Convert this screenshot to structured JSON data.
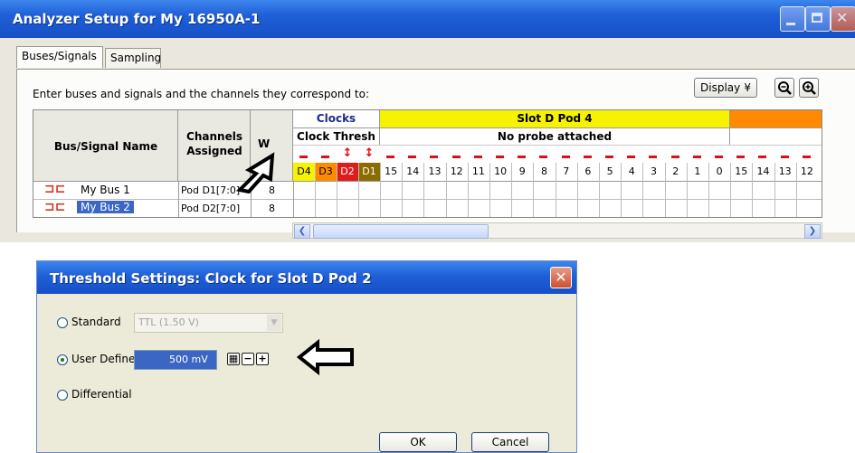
{
  "main_window": {
    "title": "Analyzer Setup for My 16950A-1",
    "tabs": [
      {
        "label": "Buses/Signals",
        "active": true
      },
      {
        "label": "Sampling",
        "active": false
      }
    ],
    "instruction": "Enter buses and signals and the channels they correspond to:",
    "display_button": "Display",
    "display_chevron": "¥",
    "table": {
      "col_bus_signal_name": "Bus/Signal Name",
      "col_channels": "Channels",
      "col_assigned": "Assigned",
      "col_width": "W",
      "clocks_group": "Clocks",
      "clock_thresh_label": "Clock Thresh",
      "slot_label": "Slot D Pod 4",
      "no_probe_label": "No probe attached",
      "clock_channels": [
        "D4",
        "D3",
        "D2",
        "D1"
      ],
      "pod_channels": [
        "15",
        "14",
        "13",
        "12",
        "11",
        "10",
        "9",
        "8",
        "7",
        "6",
        "5",
        "4",
        "3",
        "2",
        "1",
        "0"
      ],
      "next_pod_channels": [
        "15",
        "14",
        "13",
        "12"
      ],
      "rows": [
        {
          "name": "My Bus 1",
          "channels": "Pod D1[7:0]",
          "width": "8",
          "selected": false
        },
        {
          "name": "My Bus 2",
          "channels": "Pod D2[7:0]",
          "width": "8",
          "selected": true
        }
      ]
    },
    "colors": {
      "titlebar": "#1f5fd6",
      "slot_header": "#f7f200",
      "next_slot_header": "#ff8a00",
      "clock_d4": "#f7f200",
      "clock_d3": "#ff8a00",
      "clock_d2": "#dd1c1c",
      "clock_d1": "#8a6c00"
    }
  },
  "dialog": {
    "title": "Threshold Settings: Clock for Slot D Pod 2",
    "options": [
      {
        "label": "Standard",
        "selected": false
      },
      {
        "label": "User Defined",
        "selected": true
      },
      {
        "label": "Differential",
        "selected": false
      }
    ],
    "standard_value": "TTL (1.50 V)",
    "user_value": "500 mV",
    "ok_label": "OK",
    "cancel_label": "Cancel"
  }
}
